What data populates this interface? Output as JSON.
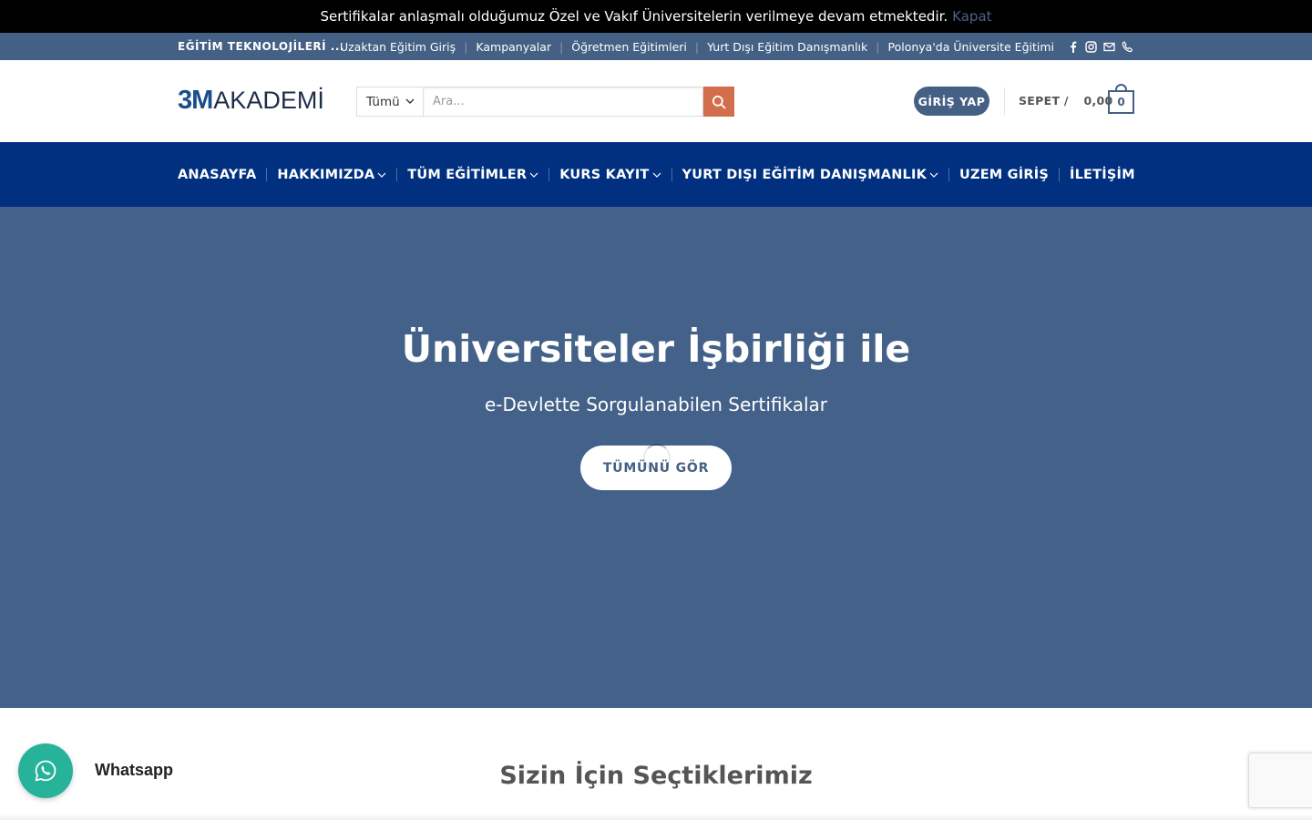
{
  "notice": {
    "text": "Sertifikalar anlaşmalı olduğumuz Özel ve Vakıf Üniversitelerin verilmeye devam etmektedir.",
    "close_label": "Kapat"
  },
  "top_bar": {
    "brand_text": "EĞİTİM TEKNOLOJİLERİ ...",
    "links": [
      "Uzaktan Eğitim Giriş",
      "Kampanyalar",
      "Öğretmen Eğitimleri",
      "Yurt Dışı Eğitim Danışmanlık",
      "Polonya'da Üniversite Eğitimi"
    ],
    "icons": [
      "facebook-icon",
      "instagram-icon",
      "email-icon",
      "phone-icon"
    ]
  },
  "header": {
    "logo_3m": "3M",
    "logo_akademi": "AKADEMİ",
    "search": {
      "category": "Tümü",
      "placeholder": "Ara..."
    },
    "login_label": "GİRİŞ YAP",
    "cart": {
      "label": "SEPET /",
      "amount": "0,00",
      "count": "0"
    }
  },
  "nav": {
    "items": [
      {
        "label": "ANASAYFA",
        "dropdown": false
      },
      {
        "label": "HAKKIMIZDA",
        "dropdown": true
      },
      {
        "label": "TÜM EĞİTİMLER",
        "dropdown": true
      },
      {
        "label": "KURS KAYIT",
        "dropdown": true
      },
      {
        "label": "YURT DIŞI EĞİTİM DANIŞMANLIK",
        "dropdown": true
      },
      {
        "label": "UZEM GİRİŞ",
        "dropdown": false
      },
      {
        "label": "İLETİŞİM",
        "dropdown": false
      }
    ]
  },
  "hero": {
    "title": "Üniversiteler İşbirliği ile",
    "subtitle": "e-Devlette Sorgulanabilen Sertifikalar",
    "button_label": "TÜMÜNÜ GÖR"
  },
  "section": {
    "title": "Sizin İçin Seçtiklerimiz"
  },
  "whatsapp": {
    "label": "Whatsapp"
  },
  "colors": {
    "primary": "#446084",
    "nav_bg": "#00307f",
    "hero_bg": "#446289",
    "search_btn": "#d26e4b",
    "whatsapp": "#26b39a"
  }
}
